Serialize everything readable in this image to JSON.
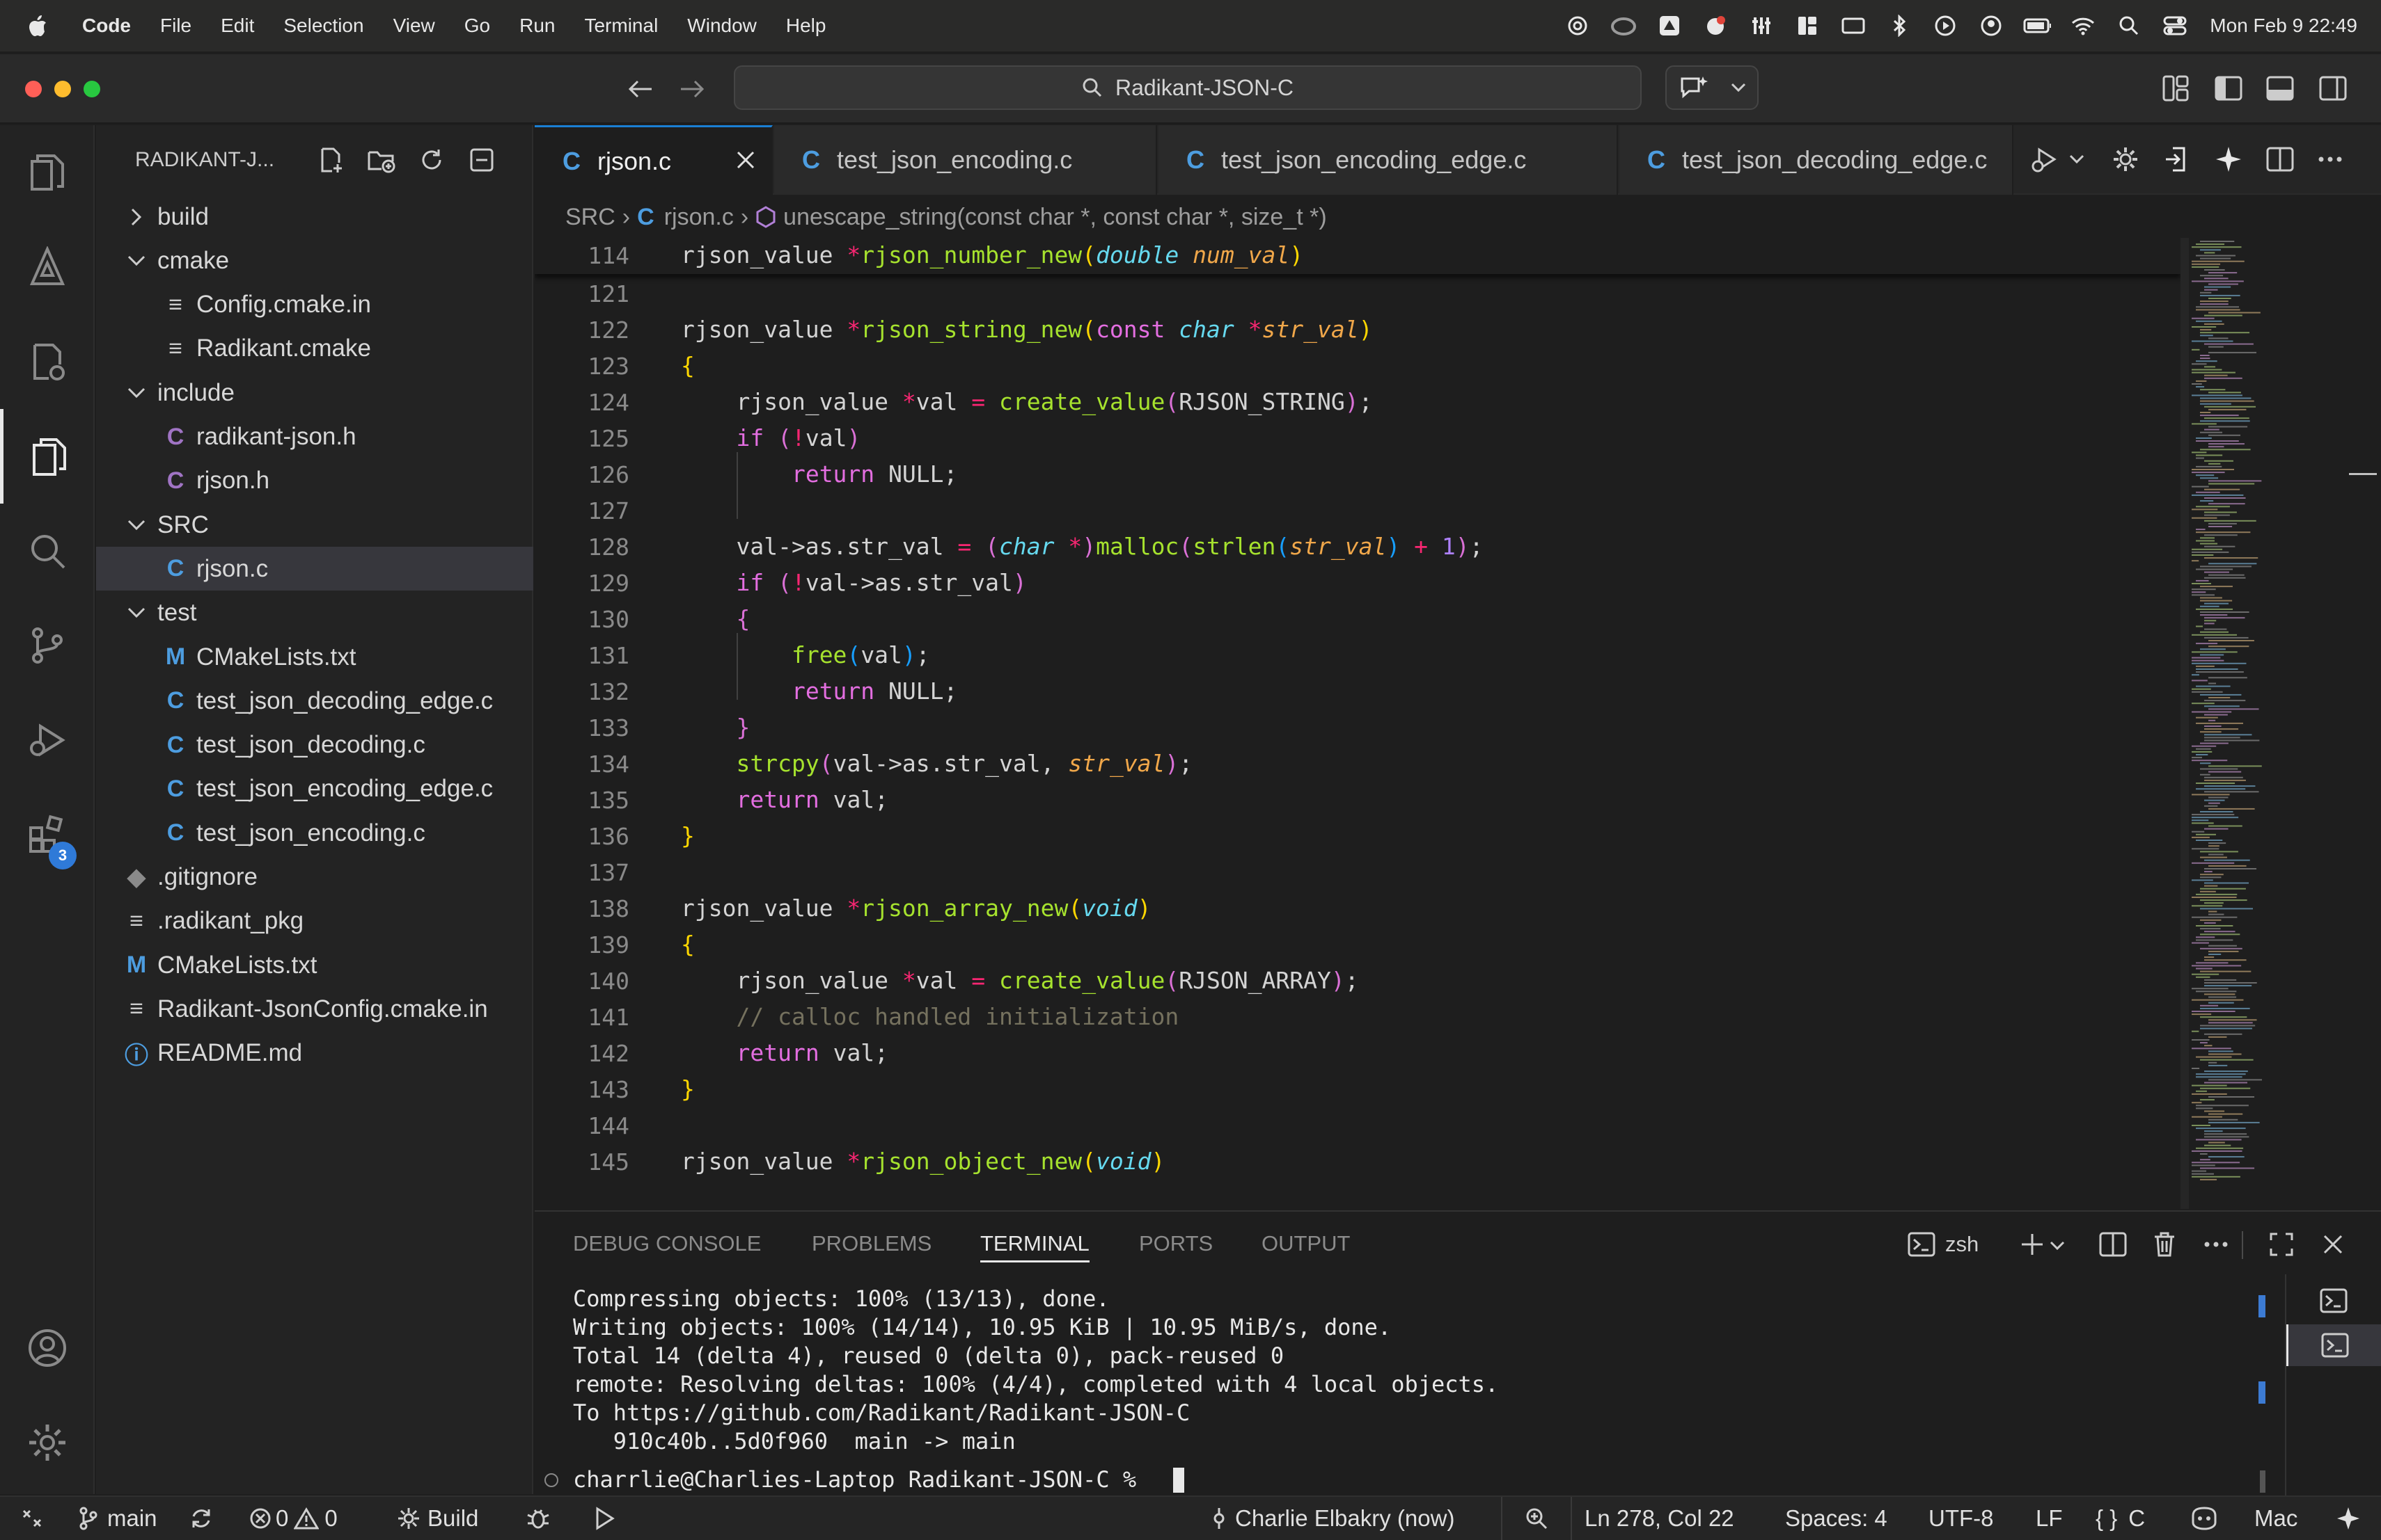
{
  "menubar": {
    "app": "Code",
    "items": [
      "File",
      "Edit",
      "Selection",
      "View",
      "Go",
      "Run",
      "Terminal",
      "Window",
      "Help"
    ],
    "clock": "Mon Feb 9  22:49"
  },
  "titlebar": {
    "search_text": "Radikant-JSON-C"
  },
  "sidebar": {
    "header": "RADIKANT-J...",
    "tree": [
      {
        "label": "build",
        "type": "folder",
        "open": false,
        "depth": 0
      },
      {
        "label": "cmake",
        "type": "folder",
        "open": true,
        "depth": 0
      },
      {
        "label": "Config.cmake.in",
        "type": "text",
        "depth": 1
      },
      {
        "label": "Radikant.cmake",
        "type": "text",
        "depth": 1
      },
      {
        "label": "include",
        "type": "folder",
        "open": true,
        "depth": 0
      },
      {
        "label": "radikant-json.h",
        "type": "c",
        "depth": 1
      },
      {
        "label": "rjson.h",
        "type": "c",
        "depth": 1
      },
      {
        "label": "SRC",
        "type": "folder",
        "open": true,
        "depth": 0
      },
      {
        "label": "rjson.c",
        "type": "c",
        "depth": 1,
        "selected": true
      },
      {
        "label": "test",
        "type": "folder",
        "open": true,
        "depth": 0
      },
      {
        "label": "CMakeLists.txt",
        "type": "cmake",
        "depth": 1
      },
      {
        "label": "test_json_decoding_edge.c",
        "type": "c",
        "depth": 1
      },
      {
        "label": "test_json_decoding.c",
        "type": "c",
        "depth": 1
      },
      {
        "label": "test_json_encoding_edge.c",
        "type": "c",
        "depth": 1
      },
      {
        "label": "test_json_encoding.c",
        "type": "c",
        "depth": 1
      },
      {
        "label": ".gitignore",
        "type": "git",
        "depth": 0
      },
      {
        "label": ".radikant_pkg",
        "type": "text",
        "depth": 0
      },
      {
        "label": "CMakeLists.txt",
        "type": "cmake",
        "depth": 0
      },
      {
        "label": "Radikant-JsonConfig.cmake.in",
        "type": "text",
        "depth": 0
      },
      {
        "label": "README.md",
        "type": "info",
        "depth": 0
      }
    ]
  },
  "activity": {
    "extensions_badge": "3"
  },
  "tabs": [
    {
      "label": "rjson.c",
      "active": true,
      "glyph": "C"
    },
    {
      "label": "test_json_encoding.c",
      "active": false,
      "glyph": "C"
    },
    {
      "label": "test_json_encoding_edge.c",
      "active": false,
      "glyph": "C"
    },
    {
      "label": "test_json_decoding_edge.c",
      "active": false,
      "glyph": "C"
    }
  ],
  "breadcrumb": {
    "folder": "SRC",
    "file": "rjson.c",
    "file_glyph": "C",
    "symbol": "unescape_string(const char *, const char *, size_t *)"
  },
  "editor": {
    "sticky": {
      "line": "114",
      "tokens": [
        [
          "t",
          "rjson_value "
        ],
        [
          "o",
          "*"
        ],
        [
          "f",
          "rjson_number_new"
        ],
        [
          "br1",
          "("
        ],
        [
          "ty",
          "double"
        ],
        [
          "t",
          " "
        ],
        [
          "p",
          "num_val"
        ],
        [
          "br1",
          ")"
        ]
      ]
    },
    "lines": [
      {
        "n": "121",
        "tokens": []
      },
      {
        "n": "122",
        "tokens": [
          [
            "t",
            "rjson_value "
          ],
          [
            "o",
            "*"
          ],
          [
            "f",
            "rjson_string_new"
          ],
          [
            "br1",
            "("
          ],
          [
            "k",
            "const"
          ],
          [
            "t",
            " "
          ],
          [
            "ty",
            "char"
          ],
          [
            "t",
            " "
          ],
          [
            "o",
            "*"
          ],
          [
            "p",
            "str_val"
          ],
          [
            "br1",
            ")"
          ]
        ]
      },
      {
        "n": "123",
        "tokens": [
          [
            "br1",
            "{"
          ]
        ]
      },
      {
        "n": "124",
        "tokens": [
          [
            "t",
            "    rjson_value "
          ],
          [
            "o",
            "*"
          ],
          [
            "t",
            "val "
          ],
          [
            "o",
            "="
          ],
          [
            "t",
            " "
          ],
          [
            "f",
            "create_value"
          ],
          [
            "br2",
            "("
          ],
          [
            "t",
            "RJSON_STRING"
          ],
          [
            "br2",
            ")"
          ],
          [
            "t",
            ";"
          ]
        ]
      },
      {
        "n": "125",
        "tokens": [
          [
            "t",
            "    "
          ],
          [
            "k",
            "if"
          ],
          [
            "t",
            " "
          ],
          [
            "br2",
            "("
          ],
          [
            "o",
            "!"
          ],
          [
            "t",
            "val"
          ],
          [
            "br2",
            ")"
          ]
        ]
      },
      {
        "n": "126",
        "tokens": [
          [
            "t",
            "        "
          ],
          [
            "k",
            "return"
          ],
          [
            "t",
            " NULL;"
          ]
        ]
      },
      {
        "n": "127",
        "tokens": []
      },
      {
        "n": "128",
        "tokens": [
          [
            "t",
            "    val->as.str_val "
          ],
          [
            "o",
            "="
          ],
          [
            "t",
            " "
          ],
          [
            "br2",
            "("
          ],
          [
            "ty",
            "char"
          ],
          [
            "t",
            " "
          ],
          [
            "o",
            "*"
          ],
          [
            "br2",
            ")"
          ],
          [
            "f",
            "malloc"
          ],
          [
            "br2",
            "("
          ],
          [
            "f",
            "strlen"
          ],
          [
            "br3",
            "("
          ],
          [
            "p",
            "str_val"
          ],
          [
            "br3",
            ")"
          ],
          [
            "t",
            " "
          ],
          [
            "o",
            "+"
          ],
          [
            "t",
            " "
          ],
          [
            "n",
            "1"
          ],
          [
            "br2",
            ")"
          ],
          [
            "t",
            ";"
          ]
        ]
      },
      {
        "n": "129",
        "tokens": [
          [
            "t",
            "    "
          ],
          [
            "k",
            "if"
          ],
          [
            "t",
            " "
          ],
          [
            "br2",
            "("
          ],
          [
            "o",
            "!"
          ],
          [
            "t",
            "val->as.str_val"
          ],
          [
            "br2",
            ")"
          ]
        ]
      },
      {
        "n": "130",
        "tokens": [
          [
            "t",
            "    "
          ],
          [
            "br2",
            "{"
          ]
        ]
      },
      {
        "n": "131",
        "tokens": [
          [
            "t",
            "        "
          ],
          [
            "f",
            "free"
          ],
          [
            "br3",
            "("
          ],
          [
            "t",
            "val"
          ],
          [
            "br3",
            ")"
          ],
          [
            "t",
            ";"
          ]
        ]
      },
      {
        "n": "132",
        "tokens": [
          [
            "t",
            "        "
          ],
          [
            "k",
            "return"
          ],
          [
            "t",
            " NULL;"
          ]
        ]
      },
      {
        "n": "133",
        "tokens": [
          [
            "t",
            "    "
          ],
          [
            "br2",
            "}"
          ]
        ]
      },
      {
        "n": "134",
        "tokens": [
          [
            "t",
            "    "
          ],
          [
            "f",
            "strcpy"
          ],
          [
            "br2",
            "("
          ],
          [
            "t",
            "val->as.str_val, "
          ],
          [
            "p",
            "str_val"
          ],
          [
            "br2",
            ")"
          ],
          [
            "t",
            ";"
          ]
        ]
      },
      {
        "n": "135",
        "tokens": [
          [
            "t",
            "    "
          ],
          [
            "k",
            "return"
          ],
          [
            "t",
            " val;"
          ]
        ]
      },
      {
        "n": "136",
        "tokens": [
          [
            "br1",
            "}"
          ]
        ]
      },
      {
        "n": "137",
        "tokens": []
      },
      {
        "n": "138",
        "tokens": [
          [
            "t",
            "rjson_value "
          ],
          [
            "o",
            "*"
          ],
          [
            "f",
            "rjson_array_new"
          ],
          [
            "br1",
            "("
          ],
          [
            "ty",
            "void"
          ],
          [
            "br1",
            ")"
          ]
        ]
      },
      {
        "n": "139",
        "tokens": [
          [
            "br1",
            "{"
          ]
        ]
      },
      {
        "n": "140",
        "tokens": [
          [
            "t",
            "    rjson_value "
          ],
          [
            "o",
            "*"
          ],
          [
            "t",
            "val "
          ],
          [
            "o",
            "="
          ],
          [
            "t",
            " "
          ],
          [
            "f",
            "create_value"
          ],
          [
            "br2",
            "("
          ],
          [
            "t",
            "RJSON_ARRAY"
          ],
          [
            "br2",
            ")"
          ],
          [
            "t",
            ";"
          ]
        ]
      },
      {
        "n": "141",
        "tokens": [
          [
            "t",
            "    "
          ],
          [
            "c",
            "// calloc handled initialization"
          ]
        ]
      },
      {
        "n": "142",
        "tokens": [
          [
            "t",
            "    "
          ],
          [
            "k",
            "return"
          ],
          [
            "t",
            " val;"
          ]
        ]
      },
      {
        "n": "143",
        "tokens": [
          [
            "br1",
            "}"
          ]
        ]
      },
      {
        "n": "144",
        "tokens": []
      },
      {
        "n": "145",
        "tokens": [
          [
            "t",
            "rjson_value "
          ],
          [
            "o",
            "*"
          ],
          [
            "f",
            "rjson_object_new"
          ],
          [
            "br1",
            "("
          ],
          [
            "ty",
            "void"
          ],
          [
            "br1",
            ")"
          ]
        ]
      }
    ]
  },
  "panel": {
    "tabs": [
      "DEBUG CONSOLE",
      "PROBLEMS",
      "TERMINAL",
      "PORTS",
      "OUTPUT"
    ],
    "active_tab": "TERMINAL",
    "shell": "zsh",
    "terminal_lines": [
      "Compressing objects: 100% (13/13), done.",
      "Writing objects: 100% (14/14), 10.95 KiB | 10.95 MiB/s, done.",
      "Total 14 (delta 4), reused 0 (delta 0), pack-reused 0",
      "remote: Resolving deltas: 100% (4/4), completed with 4 local objects.",
      "To https://github.com/Radikant/Radikant-JSON-C",
      "   910c40b..5d0f960  main -> main"
    ],
    "prompt": "charrlie@Charlies-Laptop Radikant-JSON-C % "
  },
  "statusbar": {
    "branch": "main",
    "errors": "0",
    "warnings": "0",
    "build": "Build",
    "blame": "Charlie Elbakry (now)",
    "position": "Ln 278, Col 22",
    "spaces": "Spaces: 4",
    "encoding": "UTF-8",
    "eol": "LF",
    "language": "C",
    "platform": "Mac"
  },
  "colors": {
    "accent": "#1a7fd4",
    "c_file": "#4d9de0",
    "header_file": "#a074c4",
    "cmake": "#4d9de0"
  }
}
